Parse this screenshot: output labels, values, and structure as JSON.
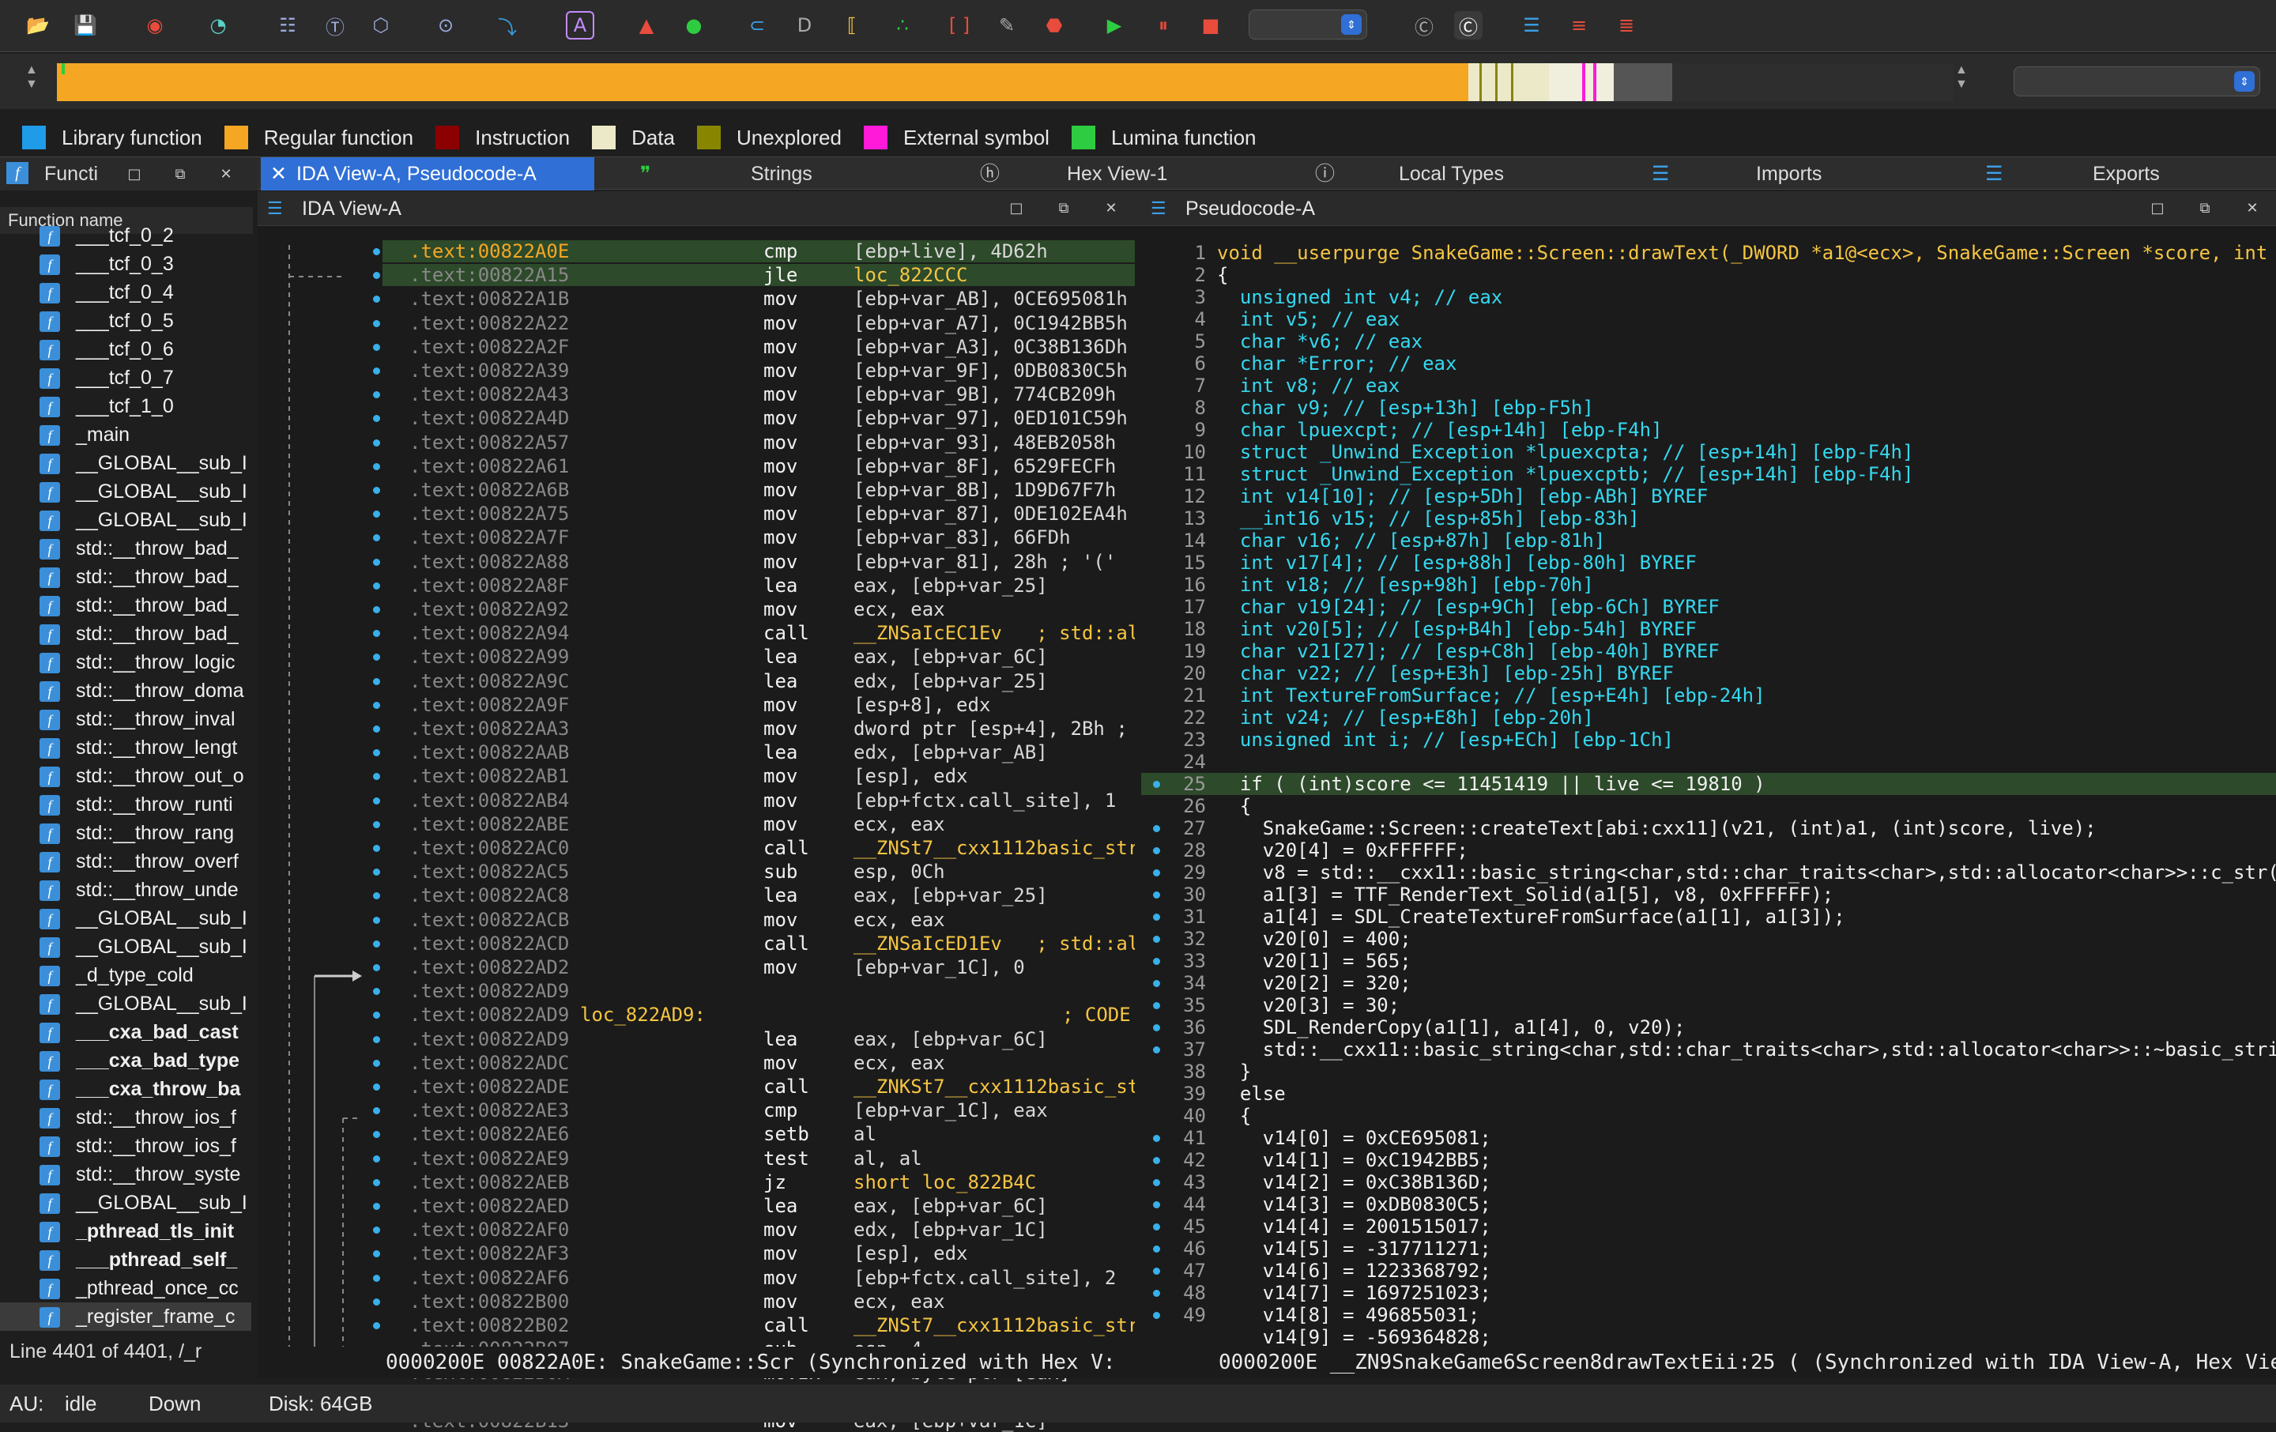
{
  "toolbar": {
    "icons": [
      "open-icon",
      "save-icon",
      "jump-back-icon",
      "jump-forward-icon",
      "new-segment-icon",
      "text-view-icon",
      "hex-icon",
      "graph-icon",
      "jump-icon",
      "string-literal-icon",
      "color-icon",
      "circle-icon",
      "xref-icon",
      "data-icon",
      "code-icon",
      "undefine-icon",
      "struct-icon",
      "patch-icon",
      "breakpoint-icon",
      "run-icon",
      "pause-icon",
      "stop-icon"
    ],
    "debugger_value": "",
    "end_icons": [
      "copy-icon",
      "refresh-icon",
      "table-icon",
      "list-icon",
      "list-numbered-icon"
    ]
  },
  "legend": [
    {
      "label": "Library function",
      "color": "#1f9be8"
    },
    {
      "label": "Regular function",
      "color": "#f5a623"
    },
    {
      "label": "Instruction",
      "color": "#8b0000"
    },
    {
      "label": "Data",
      "color": "#ece9c8"
    },
    {
      "label": "Unexplored",
      "color": "#888600"
    },
    {
      "label": "External symbol",
      "color": "#ff1ad9"
    },
    {
      "label": "Lumina function",
      "color": "#2ecc40"
    }
  ],
  "tabs": {
    "main": "IDA View-A, Pseudocode-A",
    "strings": "Strings",
    "hex": "Hex View-1",
    "local_types": "Local Types",
    "imports": "Imports",
    "exports": "Exports"
  },
  "functions": {
    "title": "Functi",
    "column": "Function name",
    "footer": "Line 4401 of 4401, /_r",
    "items": [
      "___tcf_0_2",
      "___tcf_0_3",
      "___tcf_0_4",
      "___tcf_0_5",
      "___tcf_0_6",
      "___tcf_0_7",
      "___tcf_1_0",
      "_main",
      "__GLOBAL__sub_I",
      "__GLOBAL__sub_I",
      "__GLOBAL__sub_I",
      "std::__throw_bad_",
      "std::__throw_bad_",
      "std::__throw_bad_",
      "std::__throw_bad_",
      "std::__throw_logic",
      "std::__throw_doma",
      "std::__throw_inval",
      "std::__throw_lengt",
      "std::__throw_out_o",
      "std::__throw_runti",
      "std::__throw_rang",
      "std::__throw_overf",
      "std::__throw_unde",
      "__GLOBAL__sub_I",
      "__GLOBAL__sub_I",
      "_d_type_cold",
      "__GLOBAL__sub_I",
      "___cxa_bad_cast",
      "___cxa_bad_type",
      "___cxa_throw_ba",
      "std::__throw_ios_f",
      "std::__throw_ios_f",
      "std::__throw_syste",
      "__GLOBAL__sub_I",
      "_pthread_tls_init",
      "___pthread_self_",
      "_pthread_once_cc",
      "_register_frame_c"
    ]
  },
  "ida": {
    "title": "IDA View-A",
    "footer": "0000200E 00822A0E: SnakeGame::Scr (Synchronized with Hex V:",
    "lines": [
      {
        "addr": ".text:00822A0E",
        "mn": "cmp",
        "op": "[ebp+live], 4D62h"
      },
      {
        "addr": ".text:00822A15",
        "mn": "jle",
        "op": "loc_822CCC"
      },
      {
        "addr": ".text:00822A1B",
        "mn": "mov",
        "op": "[ebp+var_AB], 0CE695081h"
      },
      {
        "addr": ".text:00822A22",
        "mn": "mov",
        "op": "[ebp+var_A7], 0C1942BB5h"
      },
      {
        "addr": ".text:00822A2F",
        "mn": "mov",
        "op": "[ebp+var_A3], 0C38B136Dh"
      },
      {
        "addr": ".text:00822A39",
        "mn": "mov",
        "op": "[ebp+var_9F], 0DB0830C5h"
      },
      {
        "addr": ".text:00822A43",
        "mn": "mov",
        "op": "[ebp+var_9B], 774CB209h"
      },
      {
        "addr": ".text:00822A4D",
        "mn": "mov",
        "op": "[ebp+var_97], 0ED101C59h"
      },
      {
        "addr": ".text:00822A57",
        "mn": "mov",
        "op": "[ebp+var_93], 48EB2058h"
      },
      {
        "addr": ".text:00822A61",
        "mn": "mov",
        "op": "[ebp+var_8F], 6529FECFh"
      },
      {
        "addr": ".text:00822A6B",
        "mn": "mov",
        "op": "[ebp+var_8B], 1D9D67F7h"
      },
      {
        "addr": ".text:00822A75",
        "mn": "mov",
        "op": "[ebp+var_87], 0DE102EA4h"
      },
      {
        "addr": ".text:00822A7F",
        "mn": "mov",
        "op": "[ebp+var_83], 66FDh"
      },
      {
        "addr": ".text:00822A88",
        "mn": "mov",
        "op": "[ebp+var_81], 28h ; '('"
      },
      {
        "addr": ".text:00822A8F",
        "mn": "lea",
        "op": "eax, [ebp+var_25]"
      },
      {
        "addr": ".text:00822A92",
        "mn": "mov",
        "op": "ecx, eax"
      },
      {
        "addr": ".text:00822A94",
        "mn": "call",
        "op": "__ZNSaIcEC1Ev   ; std::al"
      },
      {
        "addr": ".text:00822A99",
        "mn": "lea",
        "op": "eax, [ebp+var_6C]"
      },
      {
        "addr": ".text:00822A9C",
        "mn": "lea",
        "op": "edx, [ebp+var_25]"
      },
      {
        "addr": ".text:00822A9F",
        "mn": "mov",
        "op": "[esp+8], edx"
      },
      {
        "addr": ".text:00822AA3",
        "mn": "mov",
        "op": "dword ptr [esp+4], 2Bh ;"
      },
      {
        "addr": ".text:00822AAB",
        "mn": "lea",
        "op": "edx, [ebp+var_AB]"
      },
      {
        "addr": ".text:00822AB1",
        "mn": "mov",
        "op": "[esp], edx"
      },
      {
        "addr": ".text:00822AB4",
        "mn": "mov",
        "op": "[ebp+fctx.call_site], 1"
      },
      {
        "addr": ".text:00822ABE",
        "mn": "mov",
        "op": "ecx, eax"
      },
      {
        "addr": ".text:00822AC0",
        "mn": "call",
        "op": "__ZNSt7__cxx1112basic_str"
      },
      {
        "addr": ".text:00822AC5",
        "mn": "sub",
        "op": "esp, 0Ch"
      },
      {
        "addr": ".text:00822AC8",
        "mn": "lea",
        "op": "eax, [ebp+var_25]"
      },
      {
        "addr": ".text:00822ACB",
        "mn": "mov",
        "op": "ecx, eax"
      },
      {
        "addr": ".text:00822ACD",
        "mn": "call",
        "op": "__ZNSaIcED1Ev   ; std::al"
      },
      {
        "addr": ".text:00822AD2",
        "mn": "mov",
        "op": "[ebp+var_1C], 0"
      },
      {
        "addr": ".text:00822AD9",
        "mn": "",
        "op": ""
      },
      {
        "addr": ".text:00822AD9",
        "mn": "",
        "op": "loc_822AD9:",
        "label": true,
        "cmt": "; CODE XR"
      },
      {
        "addr": ".text:00822AD9",
        "mn": "lea",
        "op": "eax, [ebp+var_6C]"
      },
      {
        "addr": ".text:00822ADC",
        "mn": "mov",
        "op": "ecx, eax"
      },
      {
        "addr": ".text:00822ADE",
        "mn": "call",
        "op": "__ZNKSt7__cxx1112basic_st"
      },
      {
        "addr": ".text:00822AE3",
        "mn": "cmp",
        "op": "[ebp+var_1C], eax"
      },
      {
        "addr": ".text:00822AE6",
        "mn": "setb",
        "op": "al"
      },
      {
        "addr": ".text:00822AE9",
        "mn": "test",
        "op": "al, al"
      },
      {
        "addr": ".text:00822AEB",
        "mn": "jz",
        "op": "short loc_822B4C"
      },
      {
        "addr": ".text:00822AED",
        "mn": "lea",
        "op": "eax, [ebp+var_6C]"
      },
      {
        "addr": ".text:00822AF0",
        "mn": "mov",
        "op": "edx, [ebp+var_1C]"
      },
      {
        "addr": ".text:00822AF3",
        "mn": "mov",
        "op": "[esp], edx"
      },
      {
        "addr": ".text:00822AF6",
        "mn": "mov",
        "op": "[ebp+fctx.call_site], 2"
      },
      {
        "addr": ".text:00822B00",
        "mn": "mov",
        "op": "ecx, eax"
      },
      {
        "addr": ".text:00822B02",
        "mn": "call",
        "op": "__ZNSt7__cxx1112basic_str"
      },
      {
        "addr": ".text:00822B07",
        "mn": "sub",
        "op": "esp, 4"
      },
      {
        "addr": ".text:00822B0A",
        "mn": "movzx",
        "op": "eax, byte ptr [eax]"
      },
      {
        "addr": ".text:00822B0D",
        "mn": "mov",
        "op": "byte ptr [ebp+lpuexcpt],"
      },
      {
        "addr": ".text:00822B13",
        "mn": "mov",
        "op": "eax, [ebp+var_1C]"
      }
    ]
  },
  "pseudo": {
    "title": "Pseudocode-A",
    "footer": "0000200E __ZN9SnakeGame6Screen8drawTextEii:25 ( (Synchronized with IDA View-A, Hex Vie",
    "lines": [
      {
        "n": "1",
        "t": "void __userpurge SnakeGame::Screen::drawText(_DWORD *a1@<ecx>, SnakeGame::Screen *score, int"
      },
      {
        "n": "2",
        "t": "{"
      },
      {
        "n": "3",
        "t": "  unsigned int v4; // eax"
      },
      {
        "n": "4",
        "t": "  int v5; // eax"
      },
      {
        "n": "5",
        "t": "  char *v6; // eax"
      },
      {
        "n": "6",
        "t": "  char *Error; // eax"
      },
      {
        "n": "7",
        "t": "  int v8; // eax"
      },
      {
        "n": "8",
        "t": "  char v9; // [esp+13h] [ebp-F5h]"
      },
      {
        "n": "9",
        "t": "  char lpuexcpt; // [esp+14h] [ebp-F4h]"
      },
      {
        "n": "10",
        "t": "  struct _Unwind_Exception *lpuexcpta; // [esp+14h] [ebp-F4h]"
      },
      {
        "n": "11",
        "t": "  struct _Unwind_Exception *lpuexcptb; // [esp+14h] [ebp-F4h]"
      },
      {
        "n": "12",
        "t": "  int v14[10]; // [esp+5Dh] [ebp-ABh] BYREF"
      },
      {
        "n": "13",
        "t": "  __int16 v15; // [esp+85h] [ebp-83h]"
      },
      {
        "n": "14",
        "t": "  char v16; // [esp+87h] [ebp-81h]"
      },
      {
        "n": "15",
        "t": "  int v17[4]; // [esp+88h] [ebp-80h] BYREF"
      },
      {
        "n": "16",
        "t": "  int v18; // [esp+98h] [ebp-70h]"
      },
      {
        "n": "17",
        "t": "  char v19[24]; // [esp+9Ch] [ebp-6Ch] BYREF"
      },
      {
        "n": "18",
        "t": "  int v20[5]; // [esp+B4h] [ebp-54h] BYREF"
      },
      {
        "n": "19",
        "t": "  char v21[27]; // [esp+C8h] [ebp-40h] BYREF"
      },
      {
        "n": "20",
        "t": "  char v22; // [esp+E3h] [ebp-25h] BYREF"
      },
      {
        "n": "21",
        "t": "  int TextureFromSurface; // [esp+E4h] [ebp-24h]"
      },
      {
        "n": "22",
        "t": "  int v24; // [esp+E8h] [ebp-20h]"
      },
      {
        "n": "23",
        "t": "  unsigned int i; // [esp+ECh] [ebp-1Ch]"
      },
      {
        "n": "24",
        "t": ""
      },
      {
        "n": "25",
        "t": "  if ( (int)score <= 11451419 || live <= 19810 )"
      },
      {
        "n": "26",
        "t": "  {"
      },
      {
        "n": "27",
        "t": "    SnakeGame::Screen::createText[abi:cxx11](v21, (int)a1, (int)score, live);"
      },
      {
        "n": "28",
        "t": "    v20[4] = 0xFFFFFF;"
      },
      {
        "n": "29",
        "t": "    v8 = std::__cxx11::basic_string<char,std::char_traits<char>,std::allocator<char>>::c_str("
      },
      {
        "n": "30",
        "t": "    a1[3] = TTF_RenderText_Solid(a1[5], v8, 0xFFFFFF);"
      },
      {
        "n": "31",
        "t": "    a1[4] = SDL_CreateTextureFromSurface(a1[1], a1[3]);"
      },
      {
        "n": "32",
        "t": "    v20[0] = 400;"
      },
      {
        "n": "33",
        "t": "    v20[1] = 565;"
      },
      {
        "n": "34",
        "t": "    v20[2] = 320;"
      },
      {
        "n": "35",
        "t": "    v20[3] = 30;"
      },
      {
        "n": "36",
        "t": "    SDL_RenderCopy(a1[1], a1[4], 0, v20);"
      },
      {
        "n": "37",
        "t": "    std::__cxx11::basic_string<char,std::char_traits<char>,std::allocator<char>>::~basic_stri"
      },
      {
        "n": "38",
        "t": "  }"
      },
      {
        "n": "39",
        "t": "  else"
      },
      {
        "n": "40",
        "t": "  {"
      },
      {
        "n": "41",
        "t": "    v14[0] = 0xCE695081;"
      },
      {
        "n": "42",
        "t": "    v14[1] = 0xC1942BB5;"
      },
      {
        "n": "43",
        "t": "    v14[2] = 0xC38B136D;"
      },
      {
        "n": "44",
        "t": "    v14[3] = 0xDB0830C5;"
      },
      {
        "n": "45",
        "t": "    v14[4] = 2001515017;"
      },
      {
        "n": "46",
        "t": "    v14[5] = -317711271;"
      },
      {
        "n": "47",
        "t": "    v14[6] = 1223368792;"
      },
      {
        "n": "48",
        "t": "    v14[7] = 1697251023;"
      },
      {
        "n": "49",
        "t": "    v14[8] = 496855031;"
      },
      {
        "n": "",
        "t": "    v14[9] = -569364828;"
      }
    ]
  },
  "status": {
    "au": "AU:",
    "state": "idle",
    "direction": "Down",
    "disk": "Disk: 64GB"
  }
}
